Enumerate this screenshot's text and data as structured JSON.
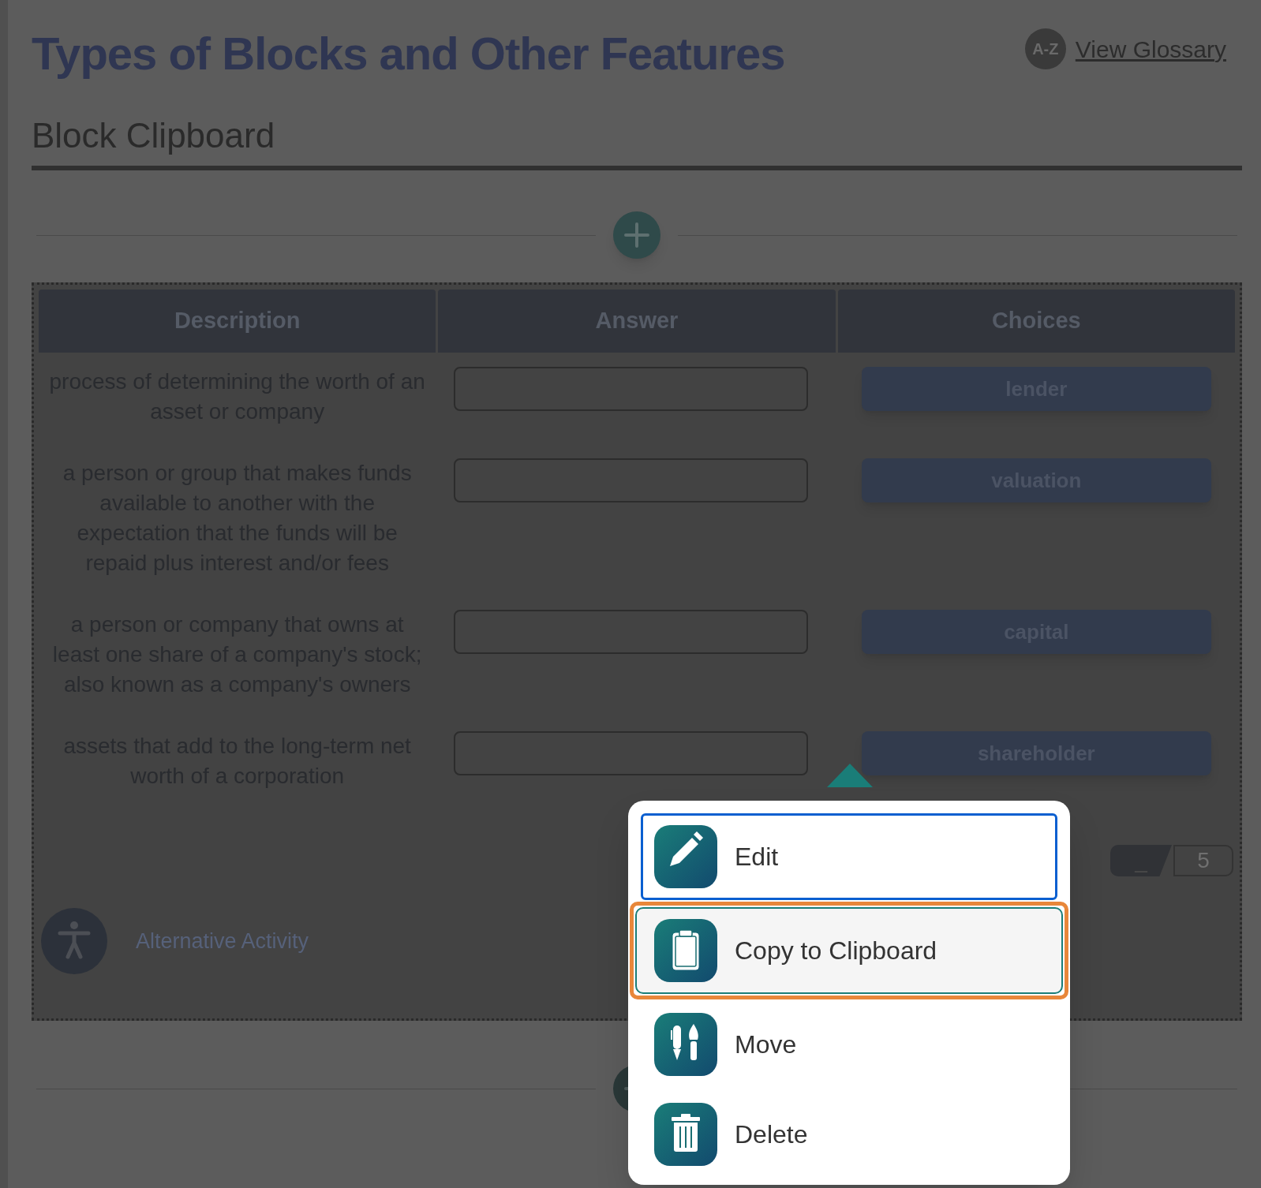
{
  "page": {
    "title": "Types of Blocks and Other Features",
    "glossary_badge": "A-Z",
    "glossary_link": "View Glossary",
    "section_title": "Block Clipboard"
  },
  "activity": {
    "columns": [
      "Description",
      "Answer",
      "Choices"
    ],
    "rows": [
      {
        "description": "process of determining the worth of an asset or company",
        "choice": "lender"
      },
      {
        "description": "a person or group that makes funds available to another with the expectation that the funds will be repaid plus interest and/or fees",
        "choice": "valuation"
      },
      {
        "description": "a person or company that owns at least one share of a company's stock; also known as a company's owners",
        "choice": "capital"
      },
      {
        "description": "assets that add to the long-term net worth of a corporation",
        "choice": "shareholder"
      }
    ],
    "pager": {
      "current": "_",
      "total": "5"
    },
    "alternative_activity": "Alternative Activity"
  },
  "context_menu": {
    "items": [
      {
        "label": "Edit",
        "kind": "edit",
        "focused": true,
        "selected": false
      },
      {
        "label": "Copy to Clipboard",
        "kind": "copy",
        "focused": false,
        "selected": true
      },
      {
        "label": "Move",
        "kind": "move",
        "focused": false,
        "selected": false
      },
      {
        "label": "Delete",
        "kind": "delete",
        "focused": false,
        "selected": false
      }
    ]
  }
}
